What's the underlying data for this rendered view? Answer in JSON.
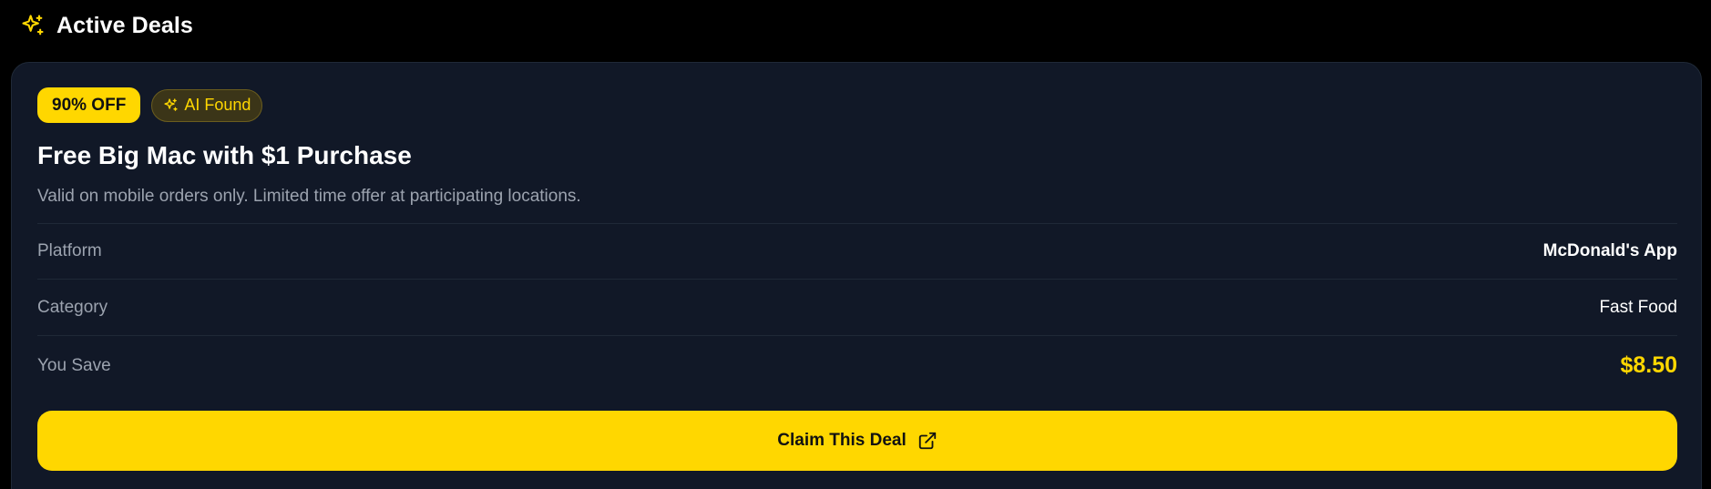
{
  "section": {
    "title": "Active Deals",
    "icon": "sparkles-icon"
  },
  "deal": {
    "discount_badge": "90% OFF",
    "ai_badge": "AI Found",
    "ai_badge_icon": "sparkles-icon",
    "title": "Free Big Mac with $1 Purchase",
    "description": "Valid on mobile orders only. Limited time offer at participating locations.",
    "details": [
      {
        "label": "Platform",
        "value": "McDonald's App"
      },
      {
        "label": "Category",
        "value": "Fast Food"
      },
      {
        "label": "You Save",
        "value": "$8.50"
      }
    ],
    "claim_button": {
      "label": "Claim This Deal",
      "icon": "external-link-icon"
    }
  },
  "colors": {
    "background": "#000000",
    "card": "#111827",
    "accent": "#ffd700",
    "muted_text": "#9ca3af",
    "divider": "#1f2937"
  }
}
